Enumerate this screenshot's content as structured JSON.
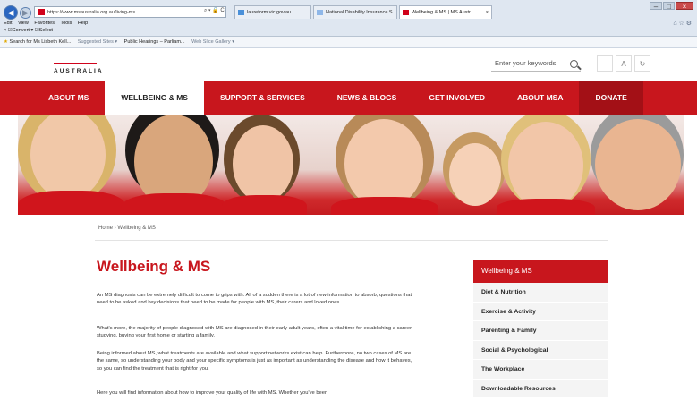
{
  "browser": {
    "address": "https://www.msaustralia.org.au/living-ms",
    "address_tools": "⌕ ▾ 🔒 C",
    "tabs": [
      {
        "label": "laureform.vic.gov.au",
        "color": "#4a90d9"
      },
      {
        "label": "National Disability Insurance S...",
        "color": "#8fb7e8"
      },
      {
        "label": "Wellbeing & MS | MS Austr...",
        "color": "#d0021b",
        "close": "×"
      }
    ],
    "menu": [
      "Edit",
      "View",
      "Favorites",
      "Tools",
      "Help"
    ],
    "command": "×  ☑Convert ▾  ☑Select",
    "favorites": [
      {
        "label": "Search for Ms Lisbeth Kell...",
        "muted": false
      },
      {
        "label": "Suggested Sites ▾",
        "muted": true
      },
      {
        "label": "Public Hearings – Parliam...",
        "muted": false
      },
      {
        "label": "Web Slice Gallery ▾",
        "muted": true
      }
    ],
    "toolbar_icons": "⌂ ☆ ⚙",
    "window_buttons": {
      "minimize": "–",
      "maximize": "□",
      "close": "×"
    }
  },
  "site": {
    "logo_text": "AUSTRALIA",
    "search_placeholder": "Enter your keywords",
    "util_buttons": [
      "−",
      "A",
      "↻"
    ],
    "nav": [
      {
        "label": "ABOUT MS",
        "state": "normal"
      },
      {
        "label": "WELLBEING & MS",
        "state": "active"
      },
      {
        "label": "SUPPORT & SERVICES",
        "state": "normal"
      },
      {
        "label": "NEWS & BLOGS",
        "state": "normal"
      },
      {
        "label": "GET INVOLVED",
        "state": "normal"
      },
      {
        "label": "ABOUT MSA",
        "state": "normal"
      },
      {
        "label": "DONATE",
        "state": "donate"
      }
    ],
    "brand_color": "#c8161d"
  },
  "content": {
    "breadcrumb": "Home › Wellbeing & MS",
    "title": "Wellbeing & MS",
    "paragraphs": [
      "An MS diagnosis can be extremely difficult to come to grips with. All of a sudden there is a lot of new information to absorb, questions that need to be asked and key decisions that need to be made for people with MS, their carers and loved ones.",
      "What's more, the majority of people diagnosed with MS are diagnosed in their early adult years, often a vital time for establishing a career, studying, buying your first home or starting a family.",
      "Being informed about MS, what treatments are available and what support networks exist can help. Furthermore, no two cases of MS are the same, so understanding your body and your specific symptoms is just as important as understanding the disease and how it behaves, so you can find the treatment that is right for you.",
      "Here you will find information about how to improve your quality of life with MS. Whether you've been"
    ]
  },
  "sidebar": {
    "heading": "Wellbeing & MS",
    "items": [
      "Diet & Nutrition",
      "Exercise & Activity",
      "Parenting & Family",
      "Social & Psychological",
      "The Workplace",
      "Downloadable Resources"
    ]
  }
}
